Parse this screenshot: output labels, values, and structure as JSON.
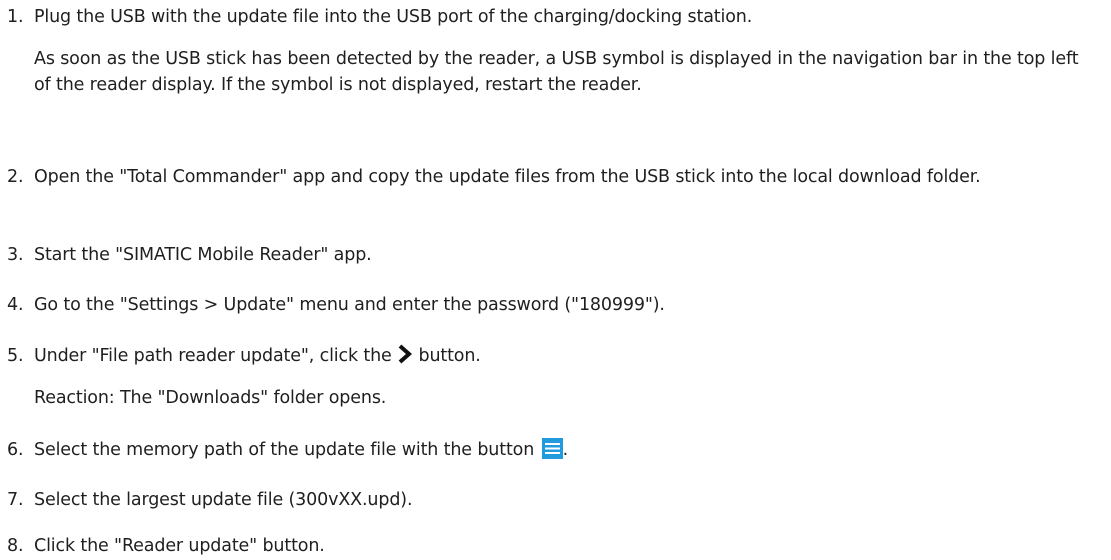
{
  "steps": [
    {
      "num": "1.",
      "text": "Plug the USB with the update file into the USB port of the charging/docking station."
    },
    {
      "num": "2.",
      "text": "Open the \"Total Commander\" app and copy the update files from the USB stick into the local download folder."
    },
    {
      "num": "3.",
      "text": "Start the \"SIMATIC Mobile Reader\" app."
    },
    {
      "num": "4.",
      "text": "Go to the \"Settings > Update\" menu and enter the password (\"180999\")."
    },
    {
      "num": "5.",
      "text_before": "Under \"File path reader update\", click the",
      "text_after": "button."
    },
    {
      "num": "6.",
      "text_before": "Select the memory path of the update file with the button",
      "text_after": "."
    },
    {
      "num": "7.",
      "text": "Select the largest update file (300vXX.upd)."
    },
    {
      "num": "8.",
      "text": "Click the \"Reader update\" button."
    }
  ],
  "step1_note": "As soon as the USB stick has been detected by the reader, a USB symbol is displayed in the navigation bar in the top left of the reader display. If the symbol is not displayed, restart the reader.",
  "step5_reaction": "Reaction: The \"Downloads\" folder opens.",
  "icons": {
    "step5": "chevron-right-icon",
    "step6": "hamburger-menu-icon"
  },
  "colors": {
    "text": "#1f1f1f",
    "menu_icon_bg": "#1f9bde"
  }
}
